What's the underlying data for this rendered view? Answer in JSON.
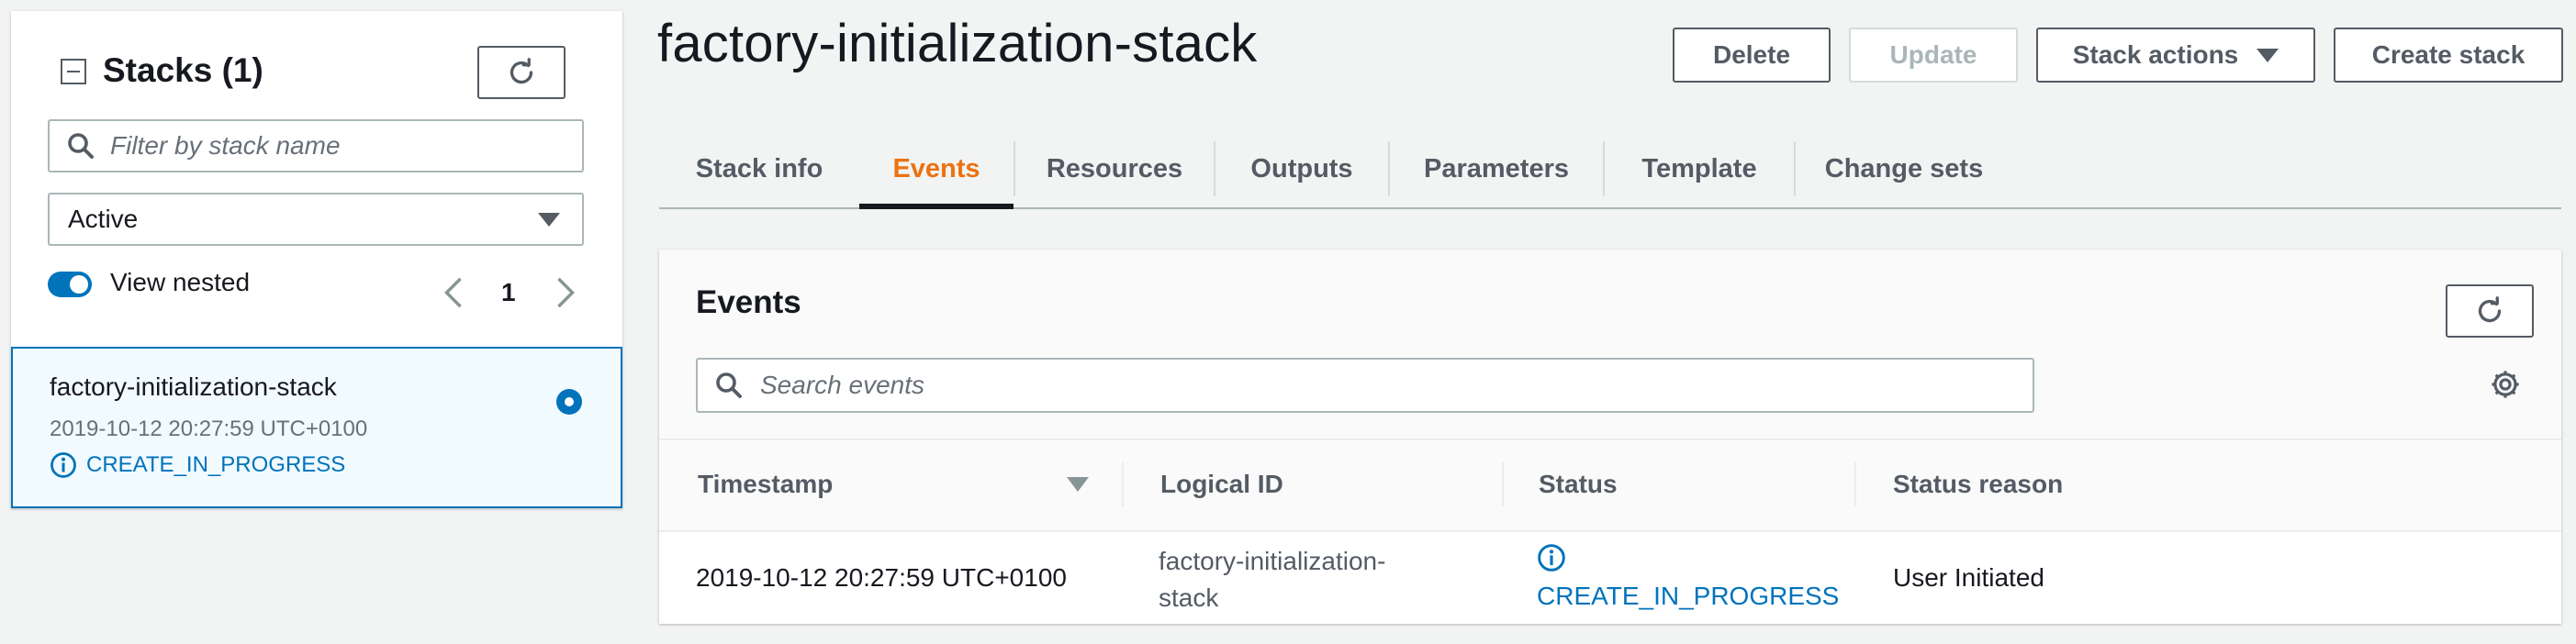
{
  "sidebar": {
    "title": "Stacks",
    "count": "(1)",
    "filter_placeholder": "Filter by stack name",
    "status_filter": "Active",
    "view_nested_label": "View nested",
    "view_nested_on": true,
    "page": "1",
    "stacks": [
      {
        "name": "factory-initialization-stack",
        "timestamp": "2019-10-12 20:27:59 UTC+0100",
        "status": "CREATE_IN_PROGRESS",
        "selected": true
      }
    ]
  },
  "header": {
    "title": "factory-initialization-stack",
    "buttons": {
      "delete": "Delete",
      "update": "Update",
      "stack_actions": "Stack actions",
      "create_stack": "Create stack"
    }
  },
  "tabs": [
    {
      "label": "Stack info",
      "active": false
    },
    {
      "label": "Events",
      "active": true
    },
    {
      "label": "Resources",
      "active": false
    },
    {
      "label": "Outputs",
      "active": false
    },
    {
      "label": "Parameters",
      "active": false
    },
    {
      "label": "Template",
      "active": false
    },
    {
      "label": "Change sets",
      "active": false
    }
  ],
  "events": {
    "title": "Events",
    "search_placeholder": "Search events",
    "columns": [
      "Timestamp",
      "Logical ID",
      "Status",
      "Status reason"
    ],
    "rows": [
      {
        "timestamp": "2019-10-12 20:27:59 UTC+0100",
        "logical_id_line1": "factory-initialization-",
        "logical_id_line2": "stack",
        "status": "CREATE_IN_PROGRESS",
        "reason": "User Initiated"
      }
    ]
  },
  "colors": {
    "accent_orange": "#ec7211",
    "link_blue": "#0073bb",
    "page_bg": "#f2f3f3"
  }
}
